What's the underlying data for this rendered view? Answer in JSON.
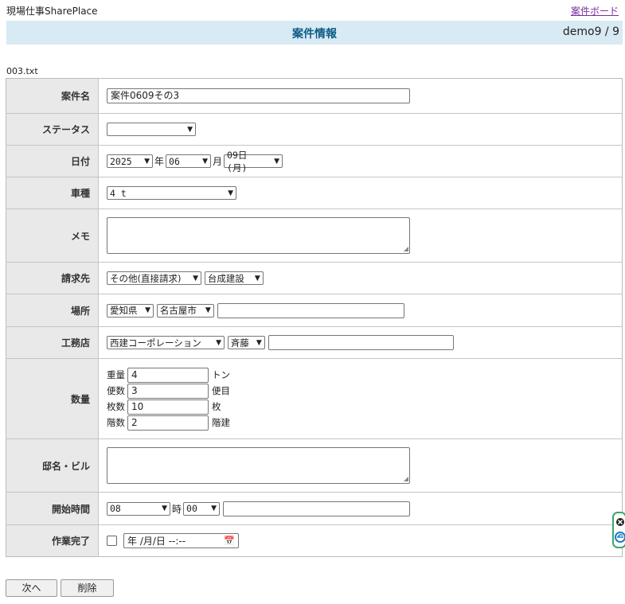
{
  "app": {
    "title": "現場仕事SharePlace",
    "board_link": "案件ボード"
  },
  "header": {
    "title": "案件情報",
    "user": "demo9 / 9"
  },
  "file_name": "003.txt",
  "form": {
    "case_name": {
      "label": "案件名",
      "value": "案件0609その3"
    },
    "status": {
      "label": "ステータス",
      "value": ""
    },
    "date": {
      "label": "日付",
      "year": "2025",
      "year_unit": "年",
      "month": "06",
      "month_unit": "月",
      "day": "09日 (月)"
    },
    "vehicle": {
      "label": "車種",
      "value": "4 t"
    },
    "memo": {
      "label": "メモ",
      "value": ""
    },
    "billing": {
      "label": "請求先",
      "type": "その他(直接請求)",
      "company": "台成建設"
    },
    "location": {
      "label": "場所",
      "prefecture": "愛知県",
      "city": "名古屋市",
      "detail": ""
    },
    "contractor": {
      "label": "工務店",
      "company": "西建コーポレーション",
      "person": "斉藤",
      "detail": ""
    },
    "quantity": {
      "label": "数量",
      "rows": [
        {
          "label": "重量",
          "value": "4",
          "unit": "トン"
        },
        {
          "label": "便数",
          "value": "3",
          "unit": "便目"
        },
        {
          "label": "枚数",
          "value": "10",
          "unit": "枚"
        },
        {
          "label": "階数",
          "value": "2",
          "unit": "階建"
        }
      ]
    },
    "building": {
      "label": "邸名・ビル",
      "value": ""
    },
    "start_time": {
      "label": "開始時間",
      "hour": "08",
      "hour_unit": "時",
      "minute": "00",
      "detail": ""
    },
    "completed": {
      "label": "作業完了",
      "datetime_placeholder": "年 /月/日  --:--"
    }
  },
  "buttons": {
    "next": "次へ",
    "delete": "削除"
  }
}
